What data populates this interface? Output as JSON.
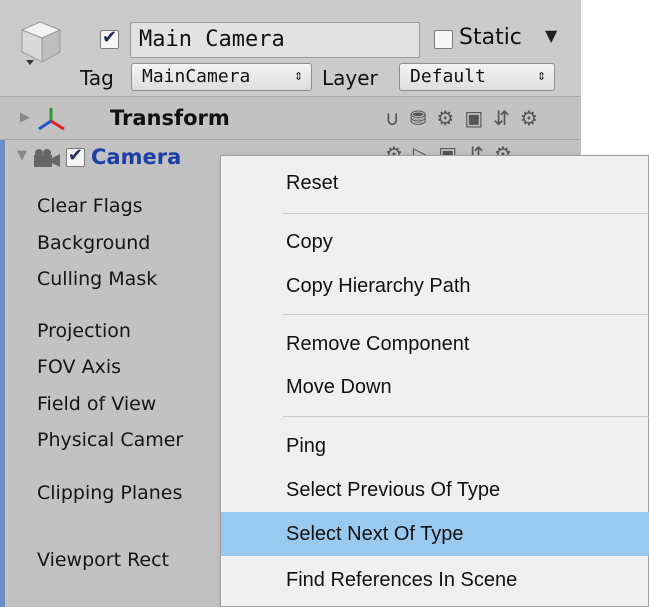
{
  "header": {
    "active": true,
    "name": "Main Camera",
    "static_label": "Static",
    "static_checked": false,
    "tag_label": "Tag",
    "tag_value": "MainCamera",
    "layer_label": "Layer",
    "layer_value": "Default"
  },
  "components": {
    "transform": {
      "title": "Transform"
    },
    "camera": {
      "title": "Camera",
      "enabled": true
    }
  },
  "camera_properties": [
    "Clear Flags",
    "Background",
    "Culling Mask",
    "Projection",
    "FOV Axis",
    "Field of View",
    "Physical Camer",
    "Clipping Planes",
    "Viewport Rect"
  ],
  "context_menu": {
    "items": [
      "Reset",
      "Copy",
      "Copy Hierarchy Path",
      "Remove Component",
      "Move Down",
      "Ping",
      "Select Previous Of Type",
      "Select Next Of Type",
      "Find References In Scene"
    ],
    "highlighted": "Select Next Of Type"
  },
  "colors": {
    "highlight": "#99c9ef",
    "camera_title": "#1c3fa8",
    "selected_bar": "#6c8ec7"
  }
}
